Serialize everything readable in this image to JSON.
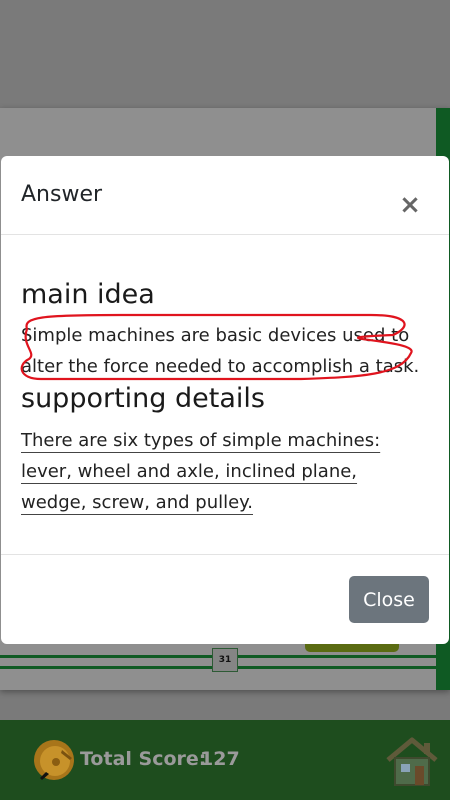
{
  "background": {
    "page_number": "31"
  },
  "footer": {
    "score_label": "Total Score:",
    "score_value": "127",
    "coin_icon": "coin-icon",
    "home_icon": "home-icon",
    "bar_color": "#1e4d1e"
  },
  "modal": {
    "title": "Answer",
    "close_symbol": "×",
    "sections": [
      {
        "heading": "main idea",
        "text": "Simple machines are basic devices used to alter the force needed to accomplish a task."
      },
      {
        "heading": "supporting details",
        "text": "There are six types of simple machines: lever, wheel and axle, inclined plane, wedge, screw, and pulley."
      }
    ],
    "close_button_label": "Close",
    "highlight_color": "#e0141e",
    "close_button_color": "#6c757d"
  }
}
